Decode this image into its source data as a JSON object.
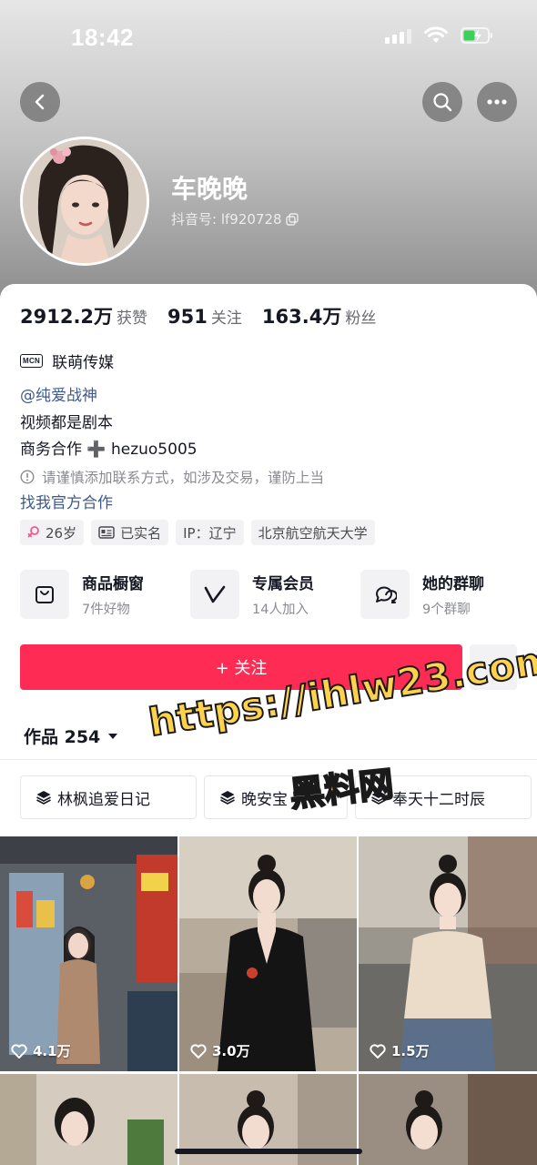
{
  "status_bar": {
    "time": "18:42"
  },
  "profile": {
    "name": "车晚晚",
    "douyin_id": "抖音号: lf920728"
  },
  "stats": [
    {
      "value": "2912.2万",
      "label": "获赞"
    },
    {
      "value": "951",
      "label": "关注"
    },
    {
      "value": "163.4万",
      "label": "粉丝"
    }
  ],
  "bio": {
    "mcn_badge": "MCN",
    "mcn_name": "联萌传媒",
    "mention": "@纯爱战神",
    "line1": "视频都是剧本",
    "line2": "商务合作 ➕ hezuo5005",
    "warning": "请谨慎添加联系方式，如涉及交易，谨防上当",
    "official_link": "找我官方合作"
  },
  "tags": [
    {
      "icon": "female-icon",
      "label": "26岁"
    },
    {
      "icon": "id-card-icon",
      "label": "已实名"
    },
    {
      "icon": "",
      "label": "IP：辽宁"
    },
    {
      "icon": "",
      "label": "北京航空航天大学"
    }
  ],
  "services": [
    {
      "icon": "shopping-bag-icon",
      "title": "商品橱窗",
      "sub": "7件好物"
    },
    {
      "icon": "vip-v-icon",
      "title": "专属会员",
      "sub": "14人加入"
    },
    {
      "icon": "group-chat-icon",
      "title": "她的群聊",
      "sub": "9个群聊"
    }
  ],
  "follow_button": {
    "label": "+ 关注"
  },
  "works_tab": {
    "label": "作品 254"
  },
  "collections": [
    {
      "label": "林枫追爱日记"
    },
    {
      "label": "晚安宝"
    },
    {
      "label": "奉天十二时辰"
    }
  ],
  "videos": [
    {
      "likes": "4.1万"
    },
    {
      "likes": "3.0万"
    },
    {
      "likes": "1.5万"
    },
    {
      "likes": ""
    },
    {
      "likes": ""
    },
    {
      "likes": ""
    }
  ],
  "watermark": {
    "url": "https://ihlw23.com",
    "name": "黑料网"
  },
  "colors": {
    "accent": "#fe2c55",
    "link": "#3f5a8a",
    "watermark": "#ffd24d"
  }
}
